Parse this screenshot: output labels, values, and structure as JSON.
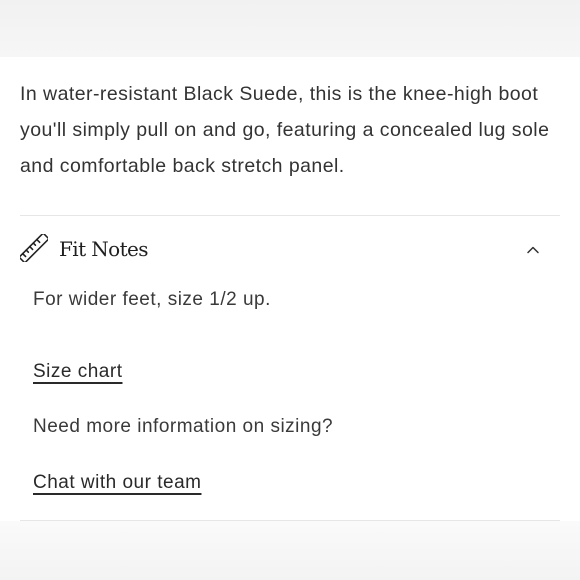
{
  "product": {
    "description": "In water-resistant Black Suede, this is the knee-high boot you'll simply pull on and go, featuring a concealed lug sole and comfortable back stretch panel."
  },
  "fit_notes": {
    "title": "Fit Notes",
    "icon": "ruler-icon",
    "toggle_icon": "chevron-up-icon",
    "expanded": true,
    "note": "For wider feet, size 1/2 up.",
    "size_chart_link": "Size chart",
    "help_question": "Need more information on sizing?",
    "chat_link": "Chat with our team"
  },
  "colors": {
    "text": "#333333",
    "divider": "#e6e6e6",
    "background": "#ffffff"
  }
}
